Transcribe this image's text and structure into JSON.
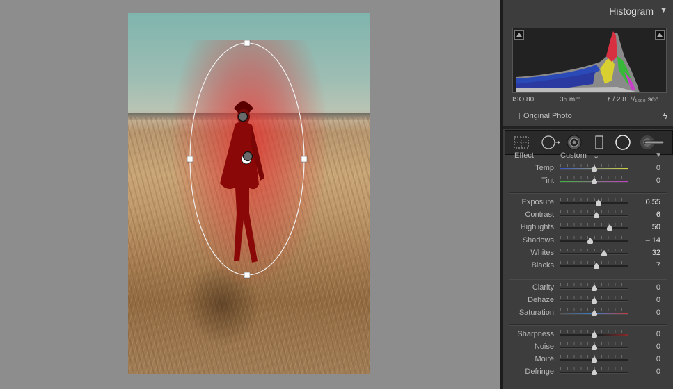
{
  "histogram": {
    "title": "Histogram",
    "iso": "ISO 80",
    "focal": "35 mm",
    "aperture": "ƒ / 2.8",
    "shutter": "¹/₁₆₀₀ sec",
    "original_photo_label": "Original Photo"
  },
  "toolbar": {
    "tools": [
      "crop-overlay-icon",
      "spot-removal-icon",
      "red-eye-icon",
      "graduated-filter-icon",
      "radial-filter-icon",
      "adjustment-brush-icon"
    ]
  },
  "effect": {
    "label": "Effect :",
    "value": "Custom"
  },
  "groups": [
    [
      {
        "label": "Temp",
        "value": "0",
        "pos": 0.5,
        "track": "linear-gradient(90deg,#3a55c8,#d8d83a)"
      },
      {
        "label": "Tint",
        "value": "0",
        "pos": 0.5,
        "track": "linear-gradient(90deg,#3ab83a,#c83ac8)"
      }
    ],
    [
      {
        "label": "Exposure",
        "value": "0.55",
        "pos": 0.56,
        "hi": true
      },
      {
        "label": "Contrast",
        "value": "6",
        "pos": 0.53,
        "hi": true
      },
      {
        "label": "Highlights",
        "value": "50",
        "pos": 0.72,
        "hi": true
      },
      {
        "label": "Shadows",
        "value": "– 14",
        "pos": 0.44,
        "hi": true
      },
      {
        "label": "Whites",
        "value": "32",
        "pos": 0.64,
        "hi": true
      },
      {
        "label": "Blacks",
        "value": "7",
        "pos": 0.53,
        "hi": true
      }
    ],
    [
      {
        "label": "Clarity",
        "value": "0",
        "pos": 0.5
      },
      {
        "label": "Dehaze",
        "value": "0",
        "pos": 0.5
      },
      {
        "label": "Saturation",
        "value": "0",
        "pos": 0.5,
        "track": "linear-gradient(90deg,#555,#3a7cc8,#c83a3a)"
      }
    ],
    [
      {
        "label": "Sharpness",
        "value": "0",
        "pos": 0.5,
        "track": "linear-gradient(90deg,#222 60%,#8a2a2a)"
      },
      {
        "label": "Noise",
        "value": "0",
        "pos": 0.5
      },
      {
        "label": "Moiré",
        "value": "0",
        "pos": 0.5
      },
      {
        "label": "Defringe",
        "value": "0",
        "pos": 0.5
      }
    ]
  ]
}
